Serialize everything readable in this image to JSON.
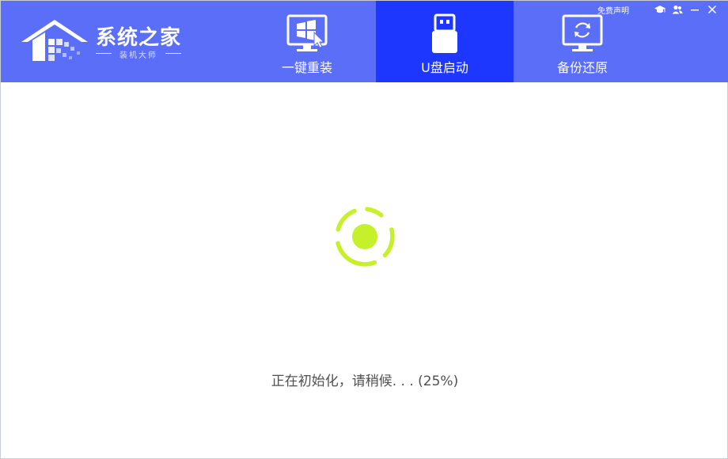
{
  "app": {
    "title": "系统之家",
    "subtitle": "装机大师",
    "disclaimer": "免费声明"
  },
  "tabs": [
    {
      "label": "一键重装",
      "icon": "windows-monitor-icon",
      "active": false
    },
    {
      "label": "U盘启动",
      "icon": "usb-drive-icon",
      "active": true
    },
    {
      "label": "备份还原",
      "icon": "backup-monitor-icon",
      "active": false
    }
  ],
  "window_controls": [
    "graduation-cap-icon",
    "users-icon",
    "minimize-icon",
    "close-icon"
  ],
  "status": {
    "message": "正在初始化，请稍候. . . (25%)",
    "progress_percent": 25
  },
  "colors": {
    "header": "#5a6ef8",
    "active_tab": "#1d37ff",
    "spinner": "#c6f02a",
    "status_text": "#505050"
  }
}
